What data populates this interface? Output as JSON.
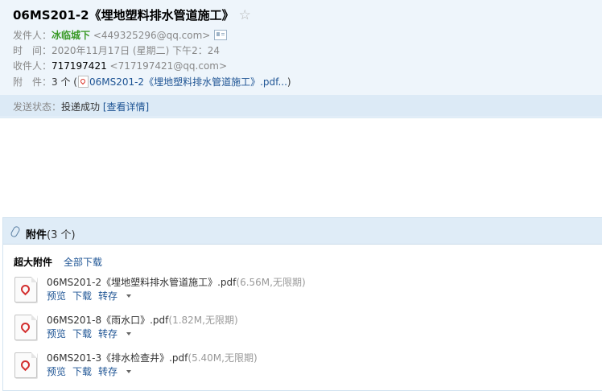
{
  "header": {
    "subject": "06MS201-2《埋地塑料排水管道施工》",
    "from_label": "发件人：",
    "from_name": "冰临城下",
    "from_email": "<449325296@qq.com>",
    "time_label": "时　间：",
    "time_value": "2020年11月17日 (星期二) 下午2：24",
    "to_label": "收件人：",
    "to_name": "717197421",
    "to_email": "<717197421@qq.com>",
    "att_label": "附　件：",
    "att_count": "3 个 (",
    "att_summary": "06MS201-2《埋地塑料排水管道施工》.pdf...",
    "att_close": ")",
    "status_label": "发送状态：",
    "status_value": "投递成功",
    "status_link": "[查看详情]"
  },
  "attachments": {
    "title": "附件",
    "count": "(3 个)",
    "big_label": "超大附件",
    "download_all": "全部下载",
    "items": [
      {
        "name": "06MS201-2《埋地塑料排水管道施工》.pdf",
        "meta": "(6.56M,无限期)",
        "preview": "预览",
        "download": "下载",
        "save": "转存"
      },
      {
        "name": "06MS201-8《雨水口》.pdf",
        "meta": "(1.82M,无限期)",
        "preview": "预览",
        "download": "下载",
        "save": "转存"
      },
      {
        "name": "06MS201-3《排水检查井》.pdf",
        "meta": "(5.40M,无限期)",
        "preview": "预览",
        "download": "下载",
        "save": "转存"
      }
    ]
  },
  "icons": {
    "star": "star-icon",
    "contact_card": "contact-card-icon",
    "paperclip": "paperclip-icon",
    "pdf": "pdf-file-icon"
  },
  "colors": {
    "header_bg": "#eef5fb",
    "status_bg": "#dceaf6",
    "link": "#1e5494",
    "sender_name": "#3a9a28",
    "pdf_red": "#d32f2f"
  }
}
